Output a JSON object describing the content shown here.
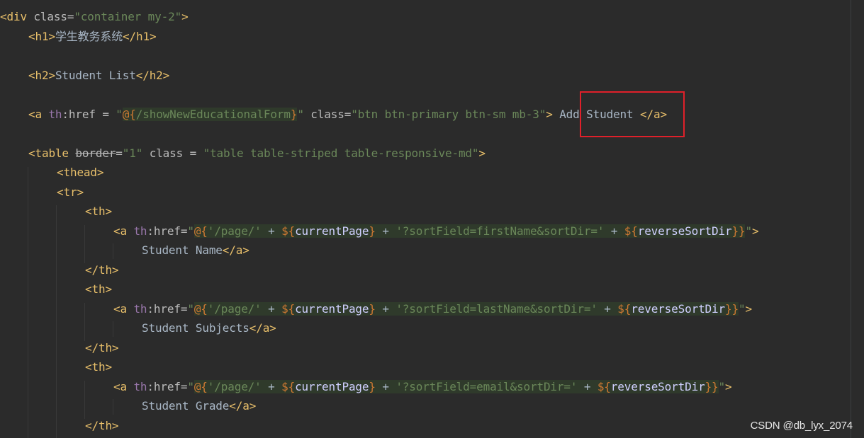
{
  "code": {
    "l1": {
      "open": "<div",
      "attr": " class=",
      "val": "\"container my-2\"",
      "close": ">"
    },
    "l2": {
      "open": "<h1>",
      "text": "学生教务系统",
      "close": "</h1>"
    },
    "l4": {
      "open": "<h2>",
      "text": "Student List",
      "close": "</h2>"
    },
    "l6": {
      "open": "<a ",
      "ns": "th",
      "attr": ":href",
      "eq": " = ",
      "q1": "\"",
      "expr_open": "@{",
      "path": "/showNewEducationalForm",
      "expr_close": "}",
      "q2": "\"",
      "attr2": " class=",
      "val2": "\"btn btn-primary btn-sm mb-3\"",
      "gt": ">",
      "text": " Add Student ",
      "close": "</a>"
    },
    "l8": {
      "open": "<table ",
      "attr_border": "border",
      "eq": "=",
      "val_border": "\"1\"",
      "attr_class": " class = ",
      "val_class": "\"table table-striped table-responsive-md\"",
      "gt": ">"
    },
    "l9": {
      "tag": "<thead>"
    },
    "l10": {
      "tag": "<tr>"
    },
    "l11": {
      "tag": "<th>"
    },
    "l12": {
      "open": "<a ",
      "ns": "th",
      "attr": ":href=",
      "q1": "\"",
      "expr_open": "@{",
      "lit1": "'/page/'",
      "plus1": " + ",
      "dollar1": "${",
      "var1": "currentPage",
      "brace1": "}",
      "plus2": " + ",
      "lit2": "'?sortField=firstName&sortDir='",
      "plus3": " + ",
      "dollar2": "${",
      "var2": "reverseSortDir",
      "brace2": "}",
      "expr_close": "}",
      "q2": "\"",
      "gt": ">"
    },
    "l13": {
      "text": "Student Name",
      "close": "</a>"
    },
    "l14": {
      "tag": "</th>"
    },
    "l15": {
      "tag": "<th>"
    },
    "l16": {
      "open": "<a ",
      "ns": "th",
      "attr": ":href=",
      "q1": "\"",
      "expr_open": "@{",
      "lit1": "'/page/'",
      "plus1": " + ",
      "dollar1": "${",
      "var1": "currentPage",
      "brace1": "}",
      "plus2": " + ",
      "lit2": "'?sortField=lastName&sortDir='",
      "plus3": " + ",
      "dollar2": "${",
      "var2": "reverseSortDir",
      "brace2": "}",
      "expr_close": "}",
      "q2": "\"",
      "gt": ">"
    },
    "l17": {
      "text": "Student Subjects",
      "close": "</a>"
    },
    "l18": {
      "tag": "</th>"
    },
    "l19": {
      "tag": "<th>"
    },
    "l20": {
      "open": "<a ",
      "ns": "th",
      "attr": ":href=",
      "q1": "\"",
      "expr_open": "@{",
      "lit1": "'/page/'",
      "plus1": " + ",
      "dollar1": "${",
      "var1": "currentPage",
      "brace1": "}",
      "plus2": " + ",
      "lit2": "'?sortField=email&sortDir='",
      "plus3": " + ",
      "dollar2": "${",
      "var2": "reverseSortDir",
      "brace2": "}",
      "expr_close": "}",
      "q2": "\"",
      "gt": ">"
    },
    "l21": {
      "text": "Student Grade",
      "close": "</a>"
    },
    "l22": {
      "tag": "</th>"
    }
  },
  "watermark": "CSDN @db_lyx_2074",
  "colors": {
    "background": "#2b2b2b",
    "tag": "#e8bf6a",
    "attribute": "#bababa",
    "string": "#6a8759",
    "thymeleaf_namespace": "#9876aa",
    "operator": "#cc7832",
    "highlight_border": "#e0202a"
  }
}
